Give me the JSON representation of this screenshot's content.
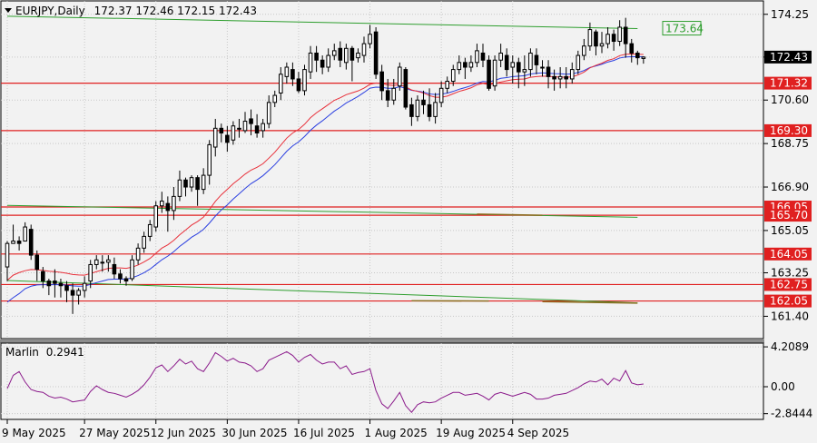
{
  "chart_data": {
    "type": "candlestick",
    "header": {
      "symbol": "EURJPY,Daily",
      "ohlc": "172.37 172.46 172.15 172.43"
    },
    "price_axis": {
      "ylim": [
        160.45,
        174.82
      ],
      "ticks": [
        "174.25",
        "172.43",
        "170.60",
        "168.75",
        "166.90",
        "165.05",
        "163.25",
        "161.40"
      ],
      "tick_values": [
        174.25,
        172.43,
        170.6,
        168.75,
        166.9,
        165.05,
        163.25,
        161.4
      ]
    },
    "date_labels": [
      "9 May 2025",
      "27 May 2025",
      "12 Jun 2025",
      "30 Jun 2025",
      "16 Jul 2025",
      "1 Aug 2025",
      "19 Aug 2025",
      "4 Sep 2025"
    ],
    "date_label_bar_index": [
      0,
      13,
      25,
      37,
      49,
      61,
      73,
      85
    ],
    "current_price": {
      "label": "172.43",
      "value": 172.43
    },
    "levels": [
      {
        "label": "171.32",
        "value": 171.32,
        "color": "#e02020"
      },
      {
        "label": "169.30",
        "value": 169.3,
        "color": "#e02020"
      },
      {
        "label": "166.05",
        "value": 166.05,
        "color": "#e02020"
      },
      {
        "label": "165.70",
        "value": 165.7,
        "color": "#e02020"
      },
      {
        "label": "164.05",
        "value": 164.05,
        "color": "#e02020"
      },
      {
        "label": "162.75",
        "value": 162.75,
        "color": "#e02020"
      },
      {
        "label": "162.05",
        "value": 162.05,
        "color": "#e02020"
      }
    ],
    "channel_label": {
      "label": "173.64",
      "value": 173.64,
      "color": "#2e9e2e"
    },
    "green_lines": [
      {
        "from": [
          0,
          174.17
        ],
        "to": [
          106,
          173.64
        ]
      },
      {
        "from": [
          0,
          166.12
        ],
        "to": [
          106,
          165.61
        ]
      },
      {
        "from": [
          0,
          162.92
        ],
        "to": [
          106,
          161.97
        ]
      }
    ],
    "brown_segments": [
      {
        "from": [
          79,
          165.75
        ],
        "to": [
          90,
          165.7
        ]
      },
      {
        "from": [
          68,
          162.06
        ],
        "to": [
          81,
          162.05
        ]
      },
      {
        "from": [
          90,
          162.02
        ],
        "to": [
          106,
          161.96
        ]
      }
    ],
    "colors": {
      "bull_body": "#ffffff",
      "bear_body": "#000000",
      "fast_ma": "#e8303a",
      "slow_ma": "#2b3fe0",
      "oscillator": "#8b1a8b",
      "grid": "#c8c8c8",
      "plot_bg": "#f2f2f2"
    },
    "candles": [
      [
        163.5,
        164.5,
        162.9,
        164.6
      ],
      [
        164.5,
        164.6,
        164.5,
        165.3
      ],
      [
        164.6,
        164.5,
        164.2,
        164.8
      ],
      [
        164.6,
        165.2,
        164.6,
        165.4
      ],
      [
        165.1,
        164.0,
        163.8,
        165.3
      ],
      [
        164.0,
        163.4,
        162.9,
        164.2
      ],
      [
        163.3,
        162.9,
        162.6,
        163.5
      ],
      [
        162.9,
        162.7,
        162.3,
        163.0
      ],
      [
        162.9,
        162.8,
        162.2,
        163.4
      ],
      [
        162.8,
        162.7,
        162.2,
        163.0
      ],
      [
        162.7,
        162.5,
        162.0,
        162.9
      ],
      [
        162.5,
        162.3,
        161.5,
        162.8
      ],
      [
        162.3,
        162.5,
        161.9,
        162.6
      ],
      [
        162.5,
        162.8,
        162.2,
        163.1
      ],
      [
        162.9,
        163.6,
        162.6,
        163.8
      ],
      [
        163.6,
        163.8,
        163.4,
        164.0
      ],
      [
        163.7,
        163.7,
        163.3,
        164.0
      ],
      [
        163.7,
        163.8,
        163.3,
        164.0
      ],
      [
        163.6,
        163.2,
        163.0,
        163.9
      ],
      [
        163.2,
        163.0,
        162.8,
        163.4
      ],
      [
        163.0,
        162.9,
        162.7,
        163.1
      ],
      [
        163.0,
        163.8,
        162.9,
        164.0
      ],
      [
        163.8,
        164.3,
        163.6,
        164.5
      ],
      [
        164.3,
        164.8,
        164.1,
        165.0
      ],
      [
        164.8,
        165.3,
        164.6,
        165.5
      ],
      [
        165.2,
        166.1,
        165.0,
        166.3
      ],
      [
        166.1,
        166.3,
        165.8,
        166.7
      ],
      [
        166.2,
        165.9,
        165.0,
        166.5
      ],
      [
        165.9,
        166.5,
        165.5,
        166.9
      ],
      [
        166.5,
        167.2,
        166.3,
        167.6
      ],
      [
        167.2,
        166.9,
        166.5,
        167.3
      ],
      [
        166.9,
        167.3,
        166.7,
        167.4
      ],
      [
        167.3,
        166.8,
        166.1,
        167.4
      ],
      [
        166.8,
        167.4,
        166.6,
        167.7
      ],
      [
        167.4,
        168.7,
        167.0,
        168.9
      ],
      [
        168.6,
        169.4,
        168.2,
        169.8
      ],
      [
        169.4,
        169.2,
        168.8,
        169.6
      ],
      [
        169.1,
        168.8,
        168.4,
        169.5
      ],
      [
        168.9,
        169.5,
        168.7,
        169.7
      ],
      [
        169.4,
        169.4,
        169.0,
        169.8
      ],
      [
        169.3,
        169.7,
        169.2,
        170.1
      ],
      [
        169.8,
        169.6,
        169.1,
        170.2
      ],
      [
        169.5,
        169.2,
        169.0,
        170.0
      ],
      [
        169.3,
        169.6,
        169.0,
        169.8
      ],
      [
        169.6,
        170.5,
        169.4,
        170.8
      ],
      [
        170.5,
        170.8,
        170.3,
        171.0
      ],
      [
        170.9,
        171.7,
        170.6,
        172.0
      ],
      [
        171.6,
        172.0,
        171.3,
        172.2
      ],
      [
        171.9,
        171.5,
        171.2,
        172.2
      ],
      [
        171.5,
        171.0,
        170.9,
        171.8
      ],
      [
        171.0,
        171.9,
        170.8,
        172.1
      ],
      [
        171.8,
        172.6,
        171.5,
        172.9
      ],
      [
        172.6,
        172.3,
        171.8,
        172.9
      ],
      [
        172.3,
        172.0,
        171.7,
        172.5
      ],
      [
        172.0,
        172.5,
        171.8,
        172.8
      ],
      [
        172.5,
        172.7,
        172.3,
        173.0
      ],
      [
        172.8,
        172.3,
        172.0,
        173.1
      ],
      [
        172.2,
        172.8,
        171.9,
        173.0
      ],
      [
        172.8,
        172.3,
        171.4,
        172.9
      ],
      [
        172.4,
        172.6,
        172.2,
        172.8
      ],
      [
        172.5,
        173.0,
        172.2,
        173.3
      ],
      [
        173.0,
        173.4,
        172.8,
        173.8
      ],
      [
        173.5,
        171.7,
        171.5,
        173.7
      ],
      [
        171.8,
        171.0,
        170.6,
        172.1
      ],
      [
        171.0,
        170.6,
        170.3,
        171.5
      ],
      [
        170.6,
        171.1,
        170.4,
        171.5
      ],
      [
        171.2,
        172.0,
        171.0,
        172.2
      ],
      [
        171.9,
        170.3,
        170.2,
        172.0
      ],
      [
        170.4,
        169.9,
        169.5,
        170.7
      ],
      [
        169.9,
        170.6,
        169.7,
        170.8
      ],
      [
        170.6,
        170.4,
        170.0,
        171.0
      ],
      [
        170.4,
        169.9,
        169.7,
        171.1
      ],
      [
        169.9,
        170.5,
        169.6,
        170.9
      ],
      [
        170.5,
        171.1,
        170.3,
        171.4
      ],
      [
        171.1,
        171.4,
        170.9,
        171.6
      ],
      [
        171.4,
        171.9,
        171.2,
        172.1
      ],
      [
        171.9,
        172.2,
        171.7,
        172.5
      ],
      [
        172.2,
        172.0,
        171.5,
        172.4
      ],
      [
        172.0,
        172.2,
        171.8,
        172.5
      ],
      [
        172.2,
        172.7,
        172.0,
        173.0
      ],
      [
        172.6,
        172.3,
        172.0,
        173.0
      ],
      [
        172.3,
        171.1,
        171.0,
        172.5
      ],
      [
        171.2,
        172.3,
        171.0,
        172.5
      ],
      [
        172.3,
        172.6,
        172.0,
        173.0
      ],
      [
        172.5,
        171.9,
        171.6,
        172.8
      ],
      [
        172.0,
        172.2,
        171.3,
        172.5
      ],
      [
        172.2,
        171.8,
        171.1,
        172.4
      ],
      [
        171.8,
        171.9,
        171.2,
        172.5
      ],
      [
        171.9,
        172.6,
        171.6,
        172.8
      ],
      [
        172.5,
        172.1,
        171.7,
        172.8
      ],
      [
        172.0,
        172.0,
        171.6,
        172.3
      ],
      [
        172.0,
        171.6,
        171.1,
        172.3
      ],
      [
        171.6,
        171.5,
        171.0,
        171.9
      ],
      [
        171.5,
        171.6,
        171.1,
        172.0
      ],
      [
        171.6,
        171.5,
        171.1,
        172.0
      ],
      [
        171.5,
        171.9,
        171.3,
        172.2
      ],
      [
        171.9,
        172.5,
        171.7,
        172.7
      ],
      [
        172.5,
        172.9,
        172.3,
        173.2
      ],
      [
        172.9,
        173.6,
        172.7,
        173.9
      ],
      [
        173.5,
        172.9,
        172.5,
        173.6
      ],
      [
        172.9,
        173.0,
        172.6,
        173.5
      ],
      [
        173.0,
        173.4,
        172.8,
        173.7
      ],
      [
        173.4,
        173.1,
        172.7,
        173.6
      ],
      [
        173.1,
        173.7,
        172.9,
        174.0
      ],
      [
        173.7,
        173.0,
        172.4,
        174.1
      ],
      [
        173.0,
        172.6,
        172.2,
        173.2
      ],
      [
        172.6,
        172.4,
        172.1,
        172.7
      ],
      [
        172.37,
        172.43,
        172.15,
        172.46
      ]
    ],
    "fast_ma": [
      162.93,
      163.15,
      163.26,
      163.34,
      163.39,
      163.38,
      163.35,
      163.32,
      163.3,
      163.27,
      163.23,
      163.18,
      163.16,
      163.15,
      163.22,
      163.3,
      163.37,
      163.44,
      163.46,
      163.46,
      163.44,
      163.49,
      163.58,
      163.71,
      163.86,
      164.08,
      164.3,
      164.44,
      164.63,
      164.87,
      165.07,
      165.28,
      165.43,
      165.62,
      165.94,
      166.29,
      166.57,
      166.8,
      167.04,
      167.24,
      167.45,
      167.62,
      167.74,
      167.89,
      168.13,
      168.38,
      168.68,
      168.98,
      169.2,
      169.35,
      169.57,
      169.85,
      170.06,
      170.23,
      170.41,
      170.59,
      170.7,
      170.83,
      170.91,
      170.99,
      171.11,
      171.27,
      171.33,
      171.31,
      171.24,
      171.22,
      171.26,
      171.16,
      171.03,
      170.97,
      170.9,
      170.79,
      170.72,
      170.72,
      170.77,
      170.87,
      170.97,
      171.04,
      171.12,
      171.25,
      171.31,
      171.25,
      171.3,
      171.37,
      171.42,
      171.47,
      171.49,
      171.5,
      171.57,
      171.6,
      171.62,
      171.61,
      171.59,
      171.58,
      171.57,
      171.59,
      171.67,
      171.79,
      171.97,
      172.08,
      172.17,
      172.29,
      172.36,
      172.49,
      172.55,
      172.56,
      172.55,
      172.54
    ]
  },
  "oscillator": {
    "name": "Marlin",
    "value_label": "0.2941",
    "ticks": [
      "4.2089",
      "0.00",
      "-2.8444"
    ],
    "tick_values": [
      4.2089,
      0.0,
      -2.8444
    ],
    "ylim": [
      -3.45,
      4.6
    ],
    "values": [
      -0.2,
      1.2,
      1.6,
      0.5,
      -0.3,
      -0.5,
      -0.6,
      -1.0,
      -1.2,
      -1.1,
      -1.3,
      -1.6,
      -1.5,
      -1.4,
      -0.5,
      0.1,
      -0.3,
      -0.6,
      -0.7,
      -0.9,
      -1.1,
      -0.8,
      -0.4,
      0.2,
      1.0,
      2.0,
      2.3,
      1.6,
      2.2,
      2.9,
      2.4,
      2.7,
      1.9,
      1.6,
      2.5,
      3.6,
      3.2,
      2.7,
      3.0,
      2.6,
      2.5,
      2.2,
      1.6,
      1.9,
      2.8,
      3.1,
      3.4,
      3.7,
      3.3,
      2.6,
      3.1,
      3.4,
      2.8,
      2.4,
      2.6,
      2.6,
      1.9,
      2.2,
      1.3,
      1.5,
      1.6,
      1.9,
      -0.4,
      -1.8,
      -2.3,
      -1.5,
      -0.6,
      -2.0,
      -2.7,
      -1.9,
      -1.6,
      -1.7,
      -1.6,
      -1.2,
      -0.9,
      -0.6,
      -0.6,
      -0.9,
      -0.8,
      -0.7,
      -1.0,
      -1.4,
      -0.8,
      -0.6,
      -0.8,
      -1.0,
      -0.8,
      -0.6,
      -0.8,
      -1.3,
      -1.3,
      -1.2,
      -0.9,
      -0.8,
      -0.7,
      -0.4,
      -0.1,
      0.3,
      0.6,
      0.5,
      0.8,
      0.2,
      0.9,
      0.6,
      1.7,
      0.4,
      0.2,
      0.29
    ]
  }
}
